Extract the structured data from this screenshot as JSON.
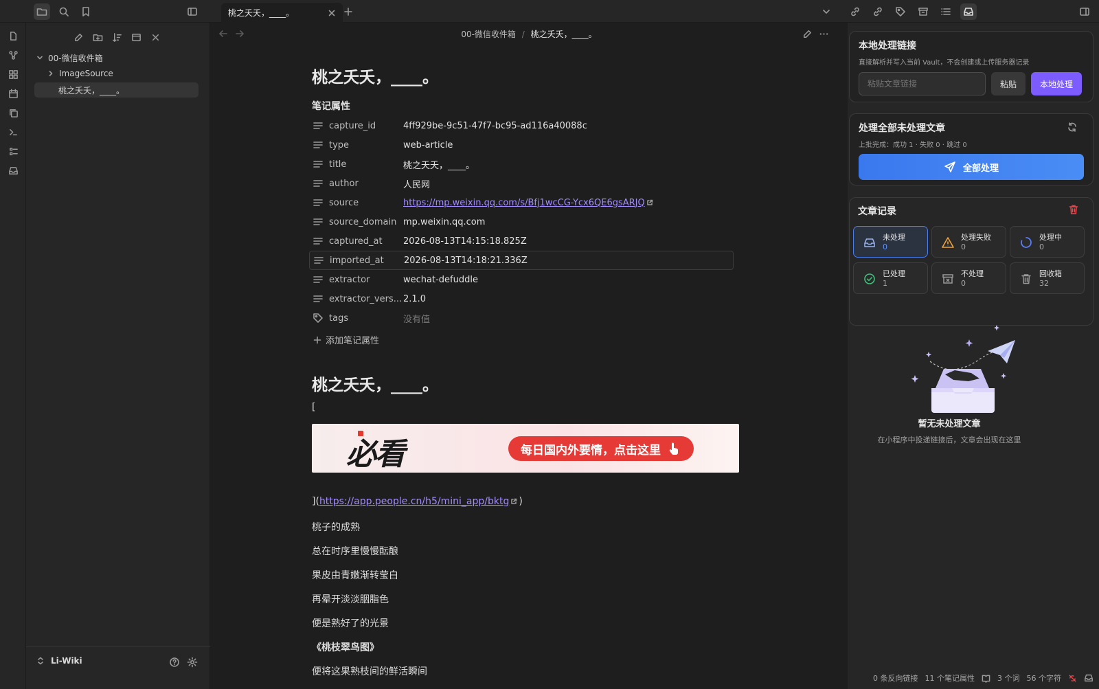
{
  "tab": {
    "title": "桃之夭夭，____。"
  },
  "breadcrumb": {
    "folder": "00-微信收件箱",
    "sep": "/",
    "note": "桃之夭夭，____。"
  },
  "tree": {
    "root": "00-微信收件箱",
    "child_folder": "ImageSource",
    "active_note": "桃之夭夭，____。"
  },
  "vault": {
    "name": "Li-Wiki"
  },
  "note": {
    "title": "桃之夭夭，____。",
    "properties_heading": "笔记属性",
    "properties": [
      {
        "key": "capture_id",
        "value": "4ff929be-9c51-47f7-bc95-ad116a40088c"
      },
      {
        "key": "type",
        "value": "web-article"
      },
      {
        "key": "title",
        "value": "桃之夭夭，____。"
      },
      {
        "key": "author",
        "value": "人民网"
      },
      {
        "key": "source",
        "value": "https://mp.weixin.qq.com/s/Bfj1wcCG-Ycx6QE6gsARJQ"
      },
      {
        "key": "source_domain",
        "value": "mp.weixin.qq.com"
      },
      {
        "key": "captured_at",
        "value": "2026-08-13T14:15:18.825Z"
      },
      {
        "key": "imported_at",
        "value": "2026-08-13T14:18:21.336Z"
      },
      {
        "key": "extractor",
        "value": "wechat-defuddle"
      },
      {
        "key": "extractor_vers...",
        "value": "2.1.0"
      },
      {
        "key": "tags",
        "value": "没有值"
      }
    ],
    "add_property": "添加笔记属性",
    "body_heading": "桃之夭夭，____。",
    "open_bracket": "[",
    "banner": {
      "logo": "必看",
      "button": "每日国内外要情，点击这里"
    },
    "link_prefix": "](",
    "link_url": "https://app.people.cn/h5/mini_app/bktg",
    "link_suffix": ")",
    "lines": [
      "桃子的成熟",
      "总在时序里慢慢酝酿",
      "果皮由青嫩渐转莹白",
      "再晕开淡淡胭脂色",
      "便是熟好了的光景"
    ],
    "bold_line": "《桃枝翠鸟图》",
    "last_line": "便将这果熟枝间的鲜活瞬间"
  },
  "plugin": {
    "local": {
      "title": "本地处理链接",
      "desc": "直接解析并写入当前 Vault，不会创建或上传服务器记录",
      "placeholder": "粘贴文章链接",
      "paste_btn": "粘贴",
      "process_btn": "本地处理"
    },
    "batch": {
      "title": "处理全部未处理文章",
      "last": "上批完成：成功 1 · 失败 0 · 跳过 0",
      "button": "全部处理"
    },
    "records": {
      "title": "文章记录",
      "stats": [
        {
          "label": "未处理",
          "count": "0"
        },
        {
          "label": "处理失败",
          "count": "0"
        },
        {
          "label": "处理中",
          "count": "0"
        },
        {
          "label": "已处理",
          "count": "1"
        },
        {
          "label": "不处理",
          "count": "0"
        },
        {
          "label": "回收箱",
          "count": "32"
        }
      ]
    },
    "empty": {
      "title": "暂无未处理文章",
      "desc": "在小程序中投递链接后，文章会出现在这里"
    },
    "colors": {
      "accent": "#7c5cff",
      "blue": "#3b7bf0",
      "success": "#3ec27a",
      "warn": "#f0a33a",
      "danger": "#e5484d"
    }
  },
  "statusbar": {
    "backlinks": "0 条反向链接",
    "props": "11 个笔记属性",
    "words": "3 个词",
    "chars": "56 个字符"
  }
}
